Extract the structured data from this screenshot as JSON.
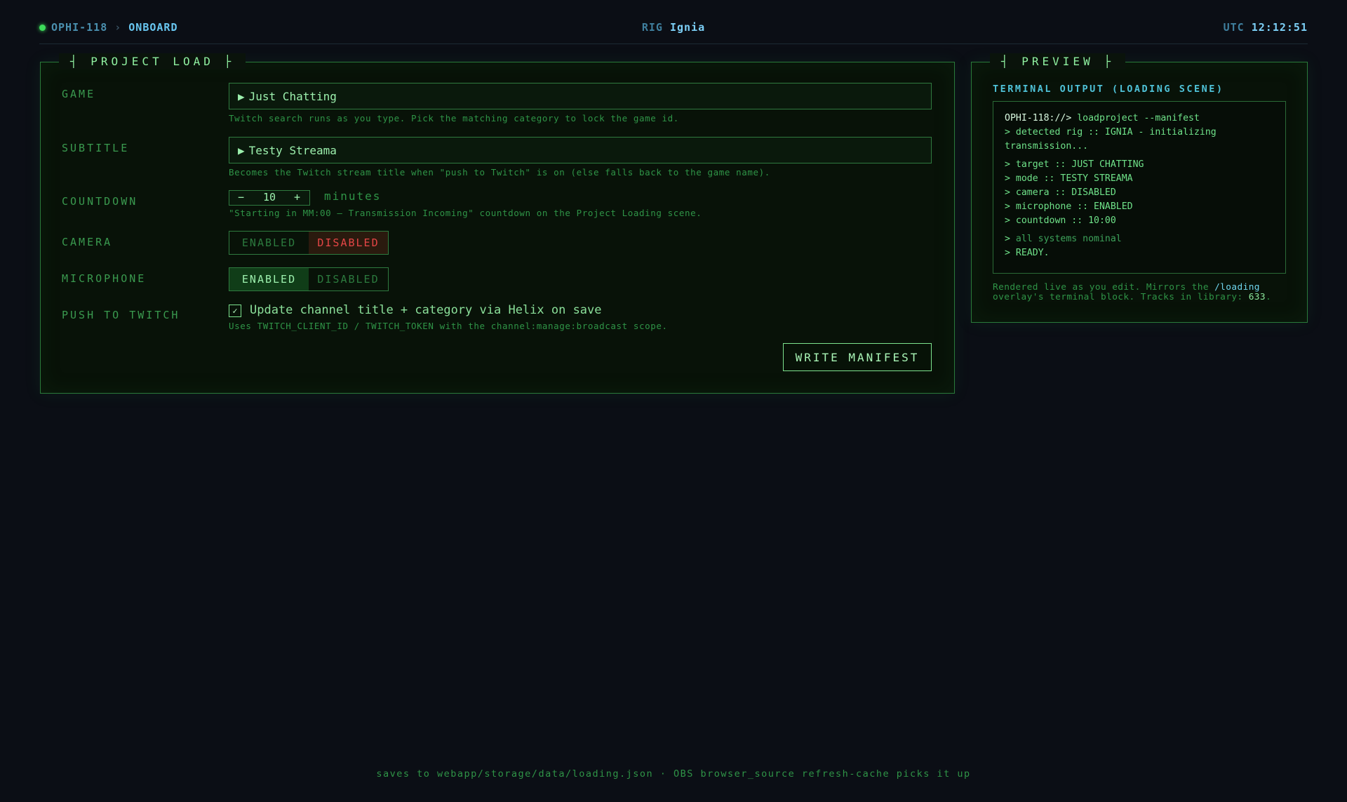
{
  "header": {
    "node_id": "OPHI-118",
    "separator": "›",
    "breadcrumb": "ONBOARD",
    "rig_label": "RIG",
    "rig_name": "Ignia",
    "clock_label": "UTC",
    "clock_time": "12:12:51"
  },
  "project_load": {
    "title": "┤ PROJECT LOAD ├",
    "game": {
      "label": "GAME",
      "value": "Just Chatting",
      "hint": "Twitch search runs as you type. Pick the matching category to lock the game id."
    },
    "subtitle": {
      "label": "SUBTITLE",
      "value": "Testy Streama",
      "hint": "Becomes the Twitch stream title when \"push to Twitch\" is on (else falls back to the game name)."
    },
    "countdown": {
      "label": "COUNTDOWN",
      "minus": "−",
      "value": "10",
      "plus": "+",
      "unit": "minutes",
      "hint": "\"Starting in MM:00 — Transmission Incoming\" countdown on the Project Loading scene."
    },
    "camera": {
      "label": "CAMERA",
      "enabled_label": "ENABLED",
      "disabled_label": "DISABLED",
      "selected": "DISABLED"
    },
    "microphone": {
      "label": "MICROPHONE",
      "enabled_label": "ENABLED",
      "disabled_label": "DISABLED",
      "selected": "ENABLED"
    },
    "push_to_twitch": {
      "label": "PUSH TO TWITCH",
      "checked": true,
      "check_mark": "✓",
      "option_label": "Update channel title + category via Helix on save",
      "hint": "Uses TWITCH_CLIENT_ID / TWITCH_TOKEN with the channel:manage:broadcast scope."
    },
    "write_button": "WRITE MANIFEST"
  },
  "preview": {
    "title": "┤ PREVIEW ├",
    "heading": "TERMINAL OUTPUT (LOADING SCENE)",
    "terminal": {
      "prompt": "OPHI-118://>",
      "command": " loadproject --manifest",
      "detected_1": "> detected rig :: IGNIA - initializing",
      "detected_2": "transmission...",
      "target": "> target :: JUST CHATTING",
      "mode": "> mode :: TESTY STREAMA",
      "camera": "> camera :: DISABLED",
      "microphone": "> microphone :: ENABLED",
      "countdown": "> countdown :: 10:00",
      "nominal_prefix": "> ",
      "nominal": "all systems nominal",
      "ready": "> READY."
    },
    "footnote_1": "Rendered live as you edit. Mirrors the ",
    "footnote_link": "/loading",
    "footnote_2": "overlay's terminal block. Tracks in library: ",
    "tracks_count": "633",
    "footnote_end": "."
  },
  "footer": "saves to webapp/storage/data/loading.json · OBS browser_source refresh-cache picks it up"
}
